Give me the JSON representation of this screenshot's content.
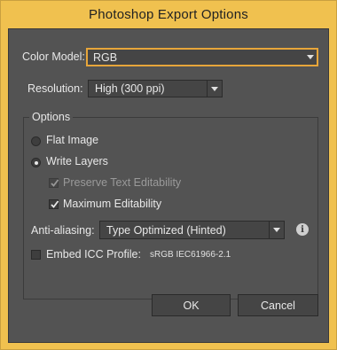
{
  "window": {
    "title": "Photoshop Export Options"
  },
  "color_model": {
    "label": "Color Model:",
    "value": "RGB"
  },
  "resolution": {
    "label": "Resolution:",
    "value": "High (300 ppi)"
  },
  "options": {
    "title": "Options",
    "flat_image": {
      "label": "Flat Image",
      "selected": false
    },
    "write_layers": {
      "label": "Write Layers",
      "selected": true
    },
    "preserve_text": {
      "label": "Preserve Text Editability",
      "checked": true,
      "enabled": false
    },
    "max_edit": {
      "label": "Maximum Editability",
      "checked": true,
      "enabled": true
    },
    "anti_aliasing": {
      "label": "Anti-aliasing:",
      "value": "Type Optimized (Hinted)",
      "info_icon": "i"
    },
    "embed_icc": {
      "label": "Embed ICC Profile:",
      "checked": false,
      "profile": "sRGB IEC61966-2.1"
    }
  },
  "buttons": {
    "ok": "OK",
    "cancel": "Cancel"
  },
  "colors": {
    "frame": "#f0c14f",
    "panel": "#535353",
    "focus": "#e7a63a"
  }
}
